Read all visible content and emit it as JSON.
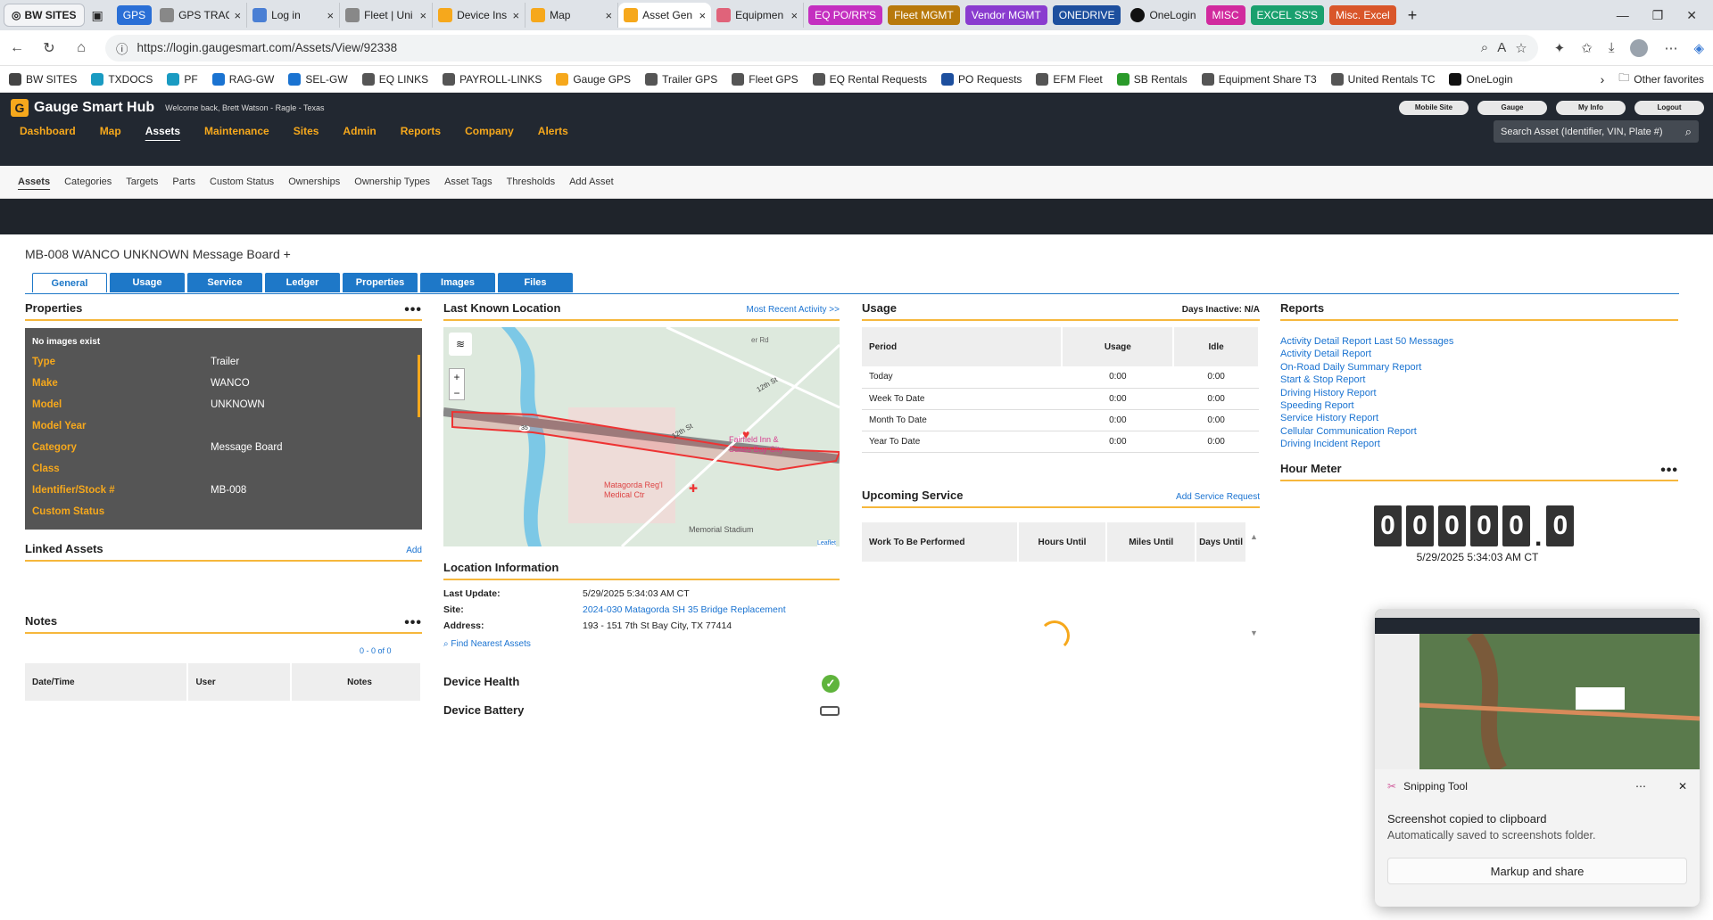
{
  "browser": {
    "workspace": "BW SITES",
    "tabs": [
      {
        "title": "GPS",
        "color": "#2a6fd6",
        "group": true
      },
      {
        "title": "GPS TRAC",
        "color": "#888"
      },
      {
        "title": "Log in",
        "color": "#4a7fd4"
      },
      {
        "title": "Fleet | Uni",
        "color": "#888"
      },
      {
        "title": "Device Ins",
        "color": "#f6a81c"
      },
      {
        "title": "Map",
        "color": "#f6a81c"
      },
      {
        "title": "Asset Gen",
        "color": "#f6a81c",
        "active": true
      },
      {
        "title": "Equipmen",
        "color": "#e0637a"
      }
    ],
    "groups": [
      {
        "label": "EQ PO/RR'S",
        "color": "#c42fc0"
      },
      {
        "label": "Fleet MGMT",
        "color": "#b8790c"
      },
      {
        "label": "Vendor MGMT",
        "color": "#8a3ccf"
      },
      {
        "label": "ONEDRIVE",
        "color": "#1d4f9e"
      }
    ],
    "onelogin": "OneLogin",
    "groups2": [
      {
        "label": "MISC",
        "color": "#d12a9e"
      },
      {
        "label": "EXCEL SS'S",
        "color": "#1aa06e"
      },
      {
        "label": "Misc. Excel",
        "color": "#d9562a"
      }
    ],
    "url": "https://login.gaugesmart.com/Assets/View/92338",
    "favorites": [
      "BW SITES",
      "TXDOCS",
      "PF",
      "RAG-GW",
      "SEL-GW",
      "EQ LINKS",
      "PAYROLL-LINKS",
      "Gauge GPS",
      "Trailer GPS",
      "Fleet GPS",
      "EQ Rental Requests",
      "PO Requests",
      "EFM Fleet",
      "SB Rentals",
      "Equipment Share T3",
      "United Rentals TC",
      "OneLogin"
    ],
    "other_favorites": "Other favorites"
  },
  "app": {
    "brand": "Gauge Smart Hub",
    "welcome": "Welcome back, Brett Watson - Ragle - Texas",
    "top_buttons": [
      "Mobile Site",
      "Gauge",
      "My Info",
      "Logout"
    ],
    "main_nav": [
      "Dashboard",
      "Map",
      "Assets",
      "Maintenance",
      "Sites",
      "Admin",
      "Reports",
      "Company",
      "Alerts"
    ],
    "search_placeholder": "Search Asset (Identifier, VIN, Plate #)",
    "sub_nav": [
      "Assets",
      "Categories",
      "Targets",
      "Parts",
      "Custom Status",
      "Ownerships",
      "Ownership Types",
      "Asset Tags",
      "Thresholds",
      "Add Asset"
    ]
  },
  "page": {
    "title": "MB-008 WANCO UNKNOWN Message Board +",
    "tabs": [
      "General",
      "Usage",
      "Service",
      "Ledger",
      "Properties",
      "Images",
      "Files"
    ],
    "properties": {
      "heading": "Properties",
      "no_images": "No images exist",
      "rows": [
        {
          "k": "Type",
          "v": "Trailer"
        },
        {
          "k": "Make",
          "v": "WANCO"
        },
        {
          "k": "Model",
          "v": "UNKNOWN"
        },
        {
          "k": "Model Year",
          "v": ""
        },
        {
          "k": "Category",
          "v": "Message Board"
        },
        {
          "k": "Class",
          "v": ""
        },
        {
          "k": "Identifier/Stock #",
          "v": "MB-008"
        },
        {
          "k": "Custom Status",
          "v": ""
        }
      ]
    },
    "linked_assets": {
      "heading": "Linked Assets",
      "action": "Add"
    },
    "notes": {
      "heading": "Notes",
      "paging": "0 - 0 of 0",
      "columns": [
        "Date/Time",
        "User",
        "Notes"
      ]
    },
    "location": {
      "heading": "Last Known Location",
      "action": "Most Recent Activity >>",
      "map_labels": {
        "street1": "12th St",
        "street2": "12th St",
        "road": "er Rd",
        "hwy": "35",
        "hotel": "Fairfield Inn & Suites Bay City",
        "hospital": "Matagorda Reg'l Medical Ctr",
        "stadium": "Memorial Stadium",
        "leaflet": "Leaflet"
      }
    },
    "location_info": {
      "heading": "Location Information",
      "rows": [
        {
          "k": "Last Update:",
          "v": "5/29/2025 5:34:03 AM CT"
        },
        {
          "k": "Site:",
          "v": "2024-030 Matagorda SH 35 Bridge Replacement"
        },
        {
          "k": "Address:",
          "v": "193 - 151 7th St Bay City, TX 77414"
        }
      ],
      "find": "Find Nearest Assets"
    },
    "device_health": "Device Health",
    "device_battery": "Device Battery",
    "usage": {
      "heading": "Usage",
      "inactive": "Days Inactive: N/A",
      "columns": [
        "Period",
        "Usage",
        "Idle"
      ],
      "rows": [
        [
          "Today",
          "0:00",
          "0:00"
        ],
        [
          "Week To Date",
          "0:00",
          "0:00"
        ],
        [
          "Month To Date",
          "0:00",
          "0:00"
        ],
        [
          "Year To Date",
          "0:00",
          "0:00"
        ]
      ]
    },
    "upcoming": {
      "heading": "Upcoming Service",
      "action": "Add Service Request",
      "columns": [
        "Work To Be Performed",
        "Hours Until",
        "Miles Until",
        "Days Until"
      ]
    },
    "reports": {
      "heading": "Reports",
      "links": [
        "Activity Detail Report Last 50 Messages",
        "Activity Detail Report",
        "On-Road Daily Summary Report",
        "Start & Stop Report",
        "Driving History Report",
        "Speeding Report",
        "Service History Report",
        "Cellular Communication Report",
        "Driving Incident Report"
      ]
    },
    "hour_meter": {
      "heading": "Hour Meter",
      "digits": [
        "0",
        "0",
        "0",
        "0",
        "0",
        "0"
      ],
      "timestamp": "5/29/2025 5:34:03 AM CT"
    }
  },
  "toast": {
    "app": "Snipping Tool",
    "title": "Screenshot copied to clipboard",
    "subtitle": "Automatically saved to screenshots folder.",
    "button": "Markup and share"
  },
  "colors": {
    "accent": "#f6a81c",
    "link": "#1a73d1",
    "tab_blue": "#1e78c8",
    "header": "#222831"
  }
}
